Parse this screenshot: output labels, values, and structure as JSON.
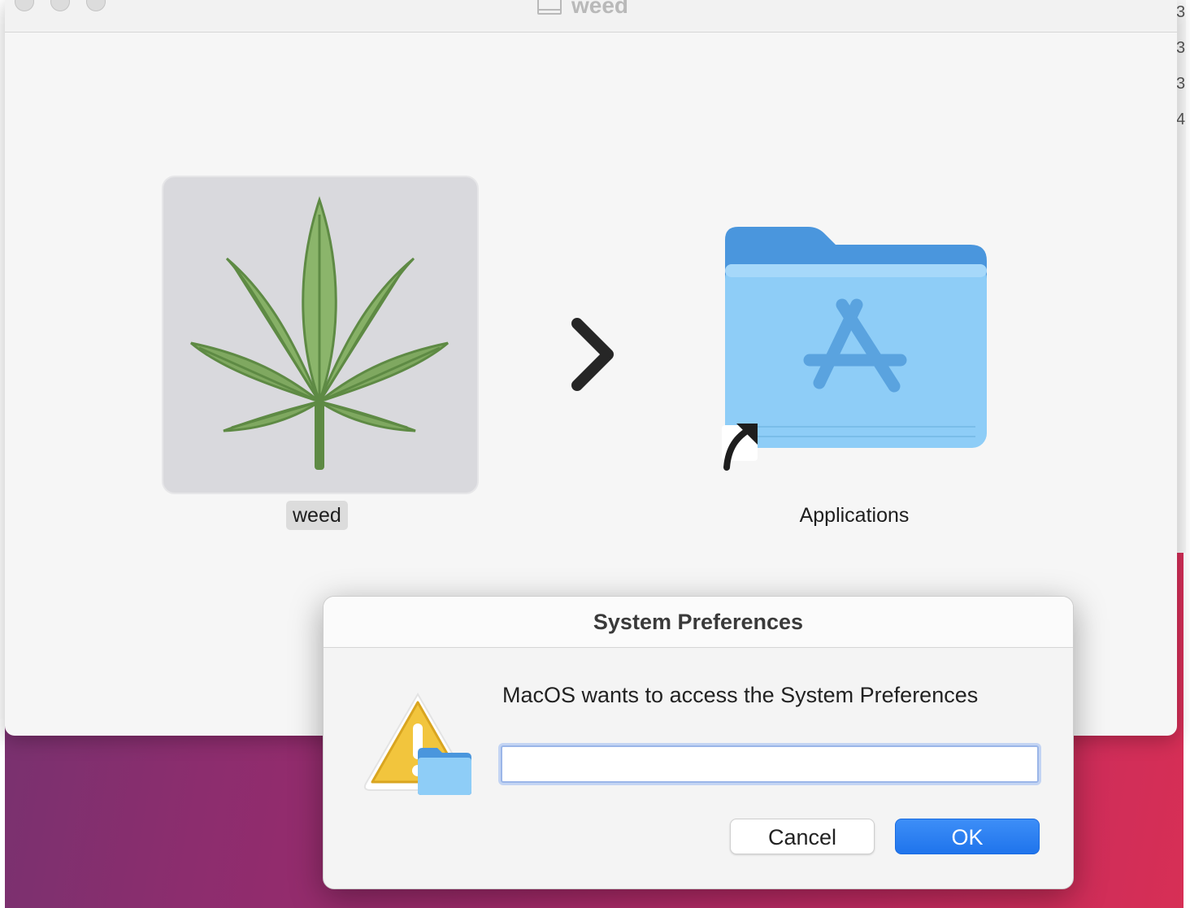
{
  "window": {
    "title": "weed"
  },
  "installer": {
    "app_label": "weed",
    "folder_label": "Applications"
  },
  "dialog": {
    "title": "System Preferences",
    "message": "MacOS wants to access the System Preferences",
    "input_value": "",
    "cancel_label": "Cancel",
    "ok_label": "OK"
  },
  "background_window": {
    "edge_glyphs": [
      "3",
      "3",
      "3",
      "4"
    ]
  },
  "icons": {
    "app_icon": "cannabis-leaf-icon",
    "arrow": "chevron-right-icon",
    "folder": "applications-folder-icon",
    "alias_badge": "alias-arrow-icon",
    "dialog_icon": "warning-folder-icon"
  },
  "colors": {
    "accent": "#1f74ec",
    "folder": "#8ecdf7",
    "leaf": "#7fa860",
    "warning": "#f2c53d"
  }
}
